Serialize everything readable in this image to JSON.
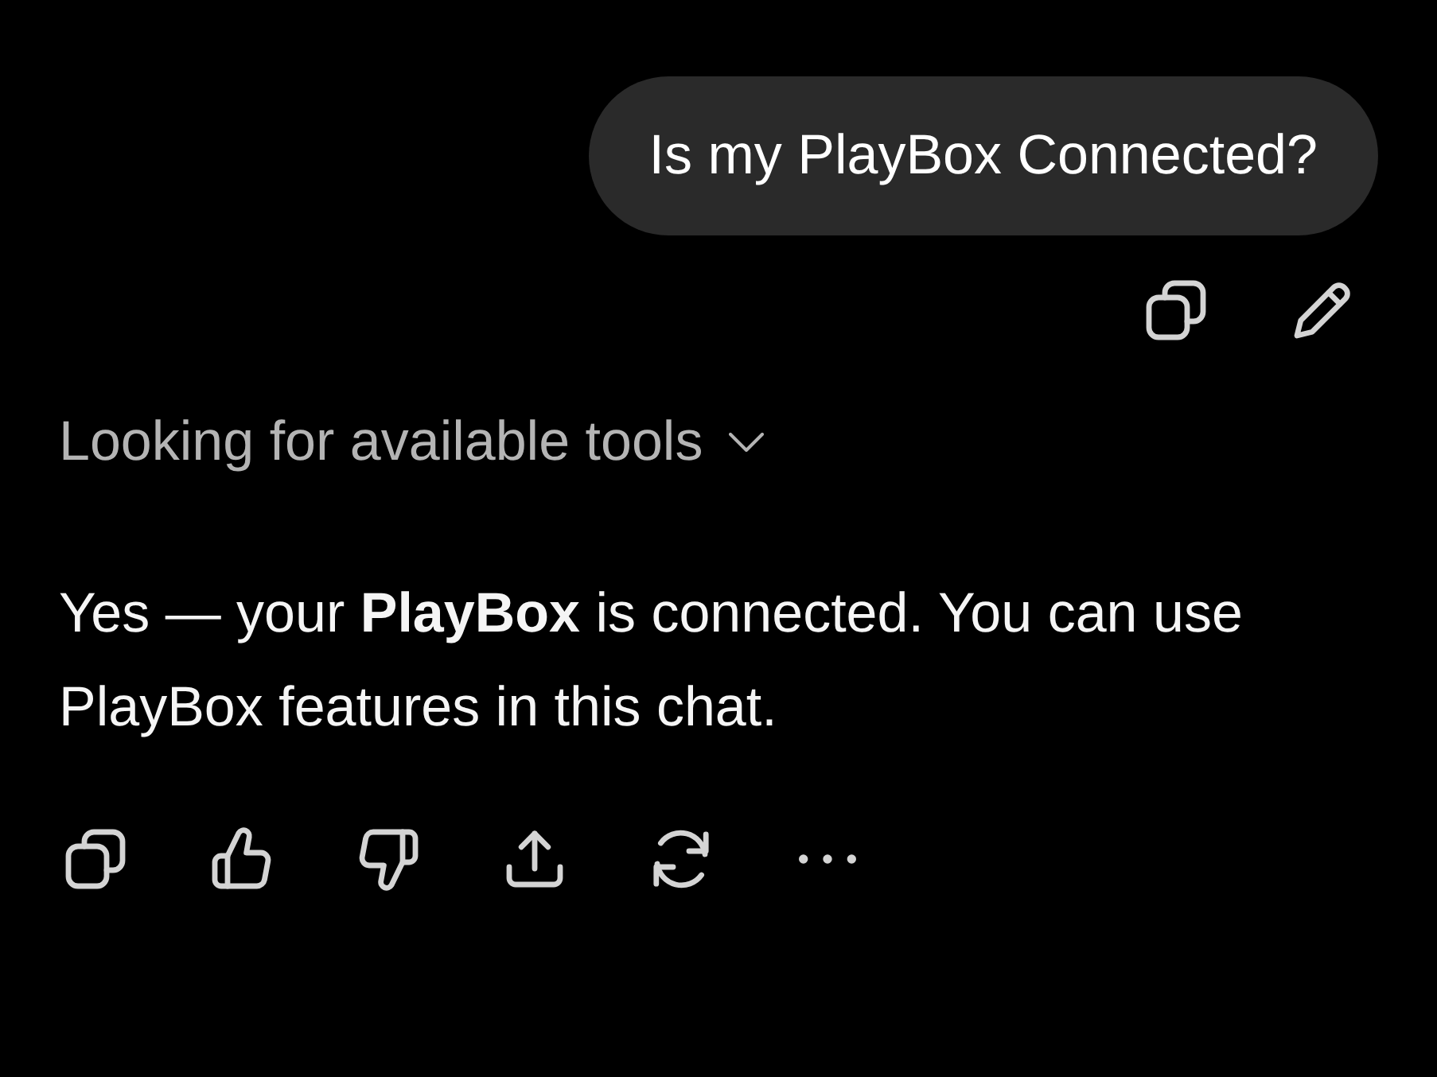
{
  "user_message": {
    "text": "Is my PlayBox Connected?"
  },
  "message_actions": [
    {
      "kind": "copy"
    },
    {
      "kind": "edit"
    }
  ],
  "tool_status": {
    "text": "Looking for available tools",
    "expanded": false
  },
  "response": {
    "text": "Yes — your **PlayBox** is connected. You can use PlayBox features in this chat."
  },
  "response_actions": [
    {
      "kind": "copy"
    },
    {
      "kind": "like"
    },
    {
      "kind": "dislike"
    },
    {
      "kind": "share"
    },
    {
      "kind": "regenerate"
    },
    {
      "kind": "more"
    }
  ]
}
